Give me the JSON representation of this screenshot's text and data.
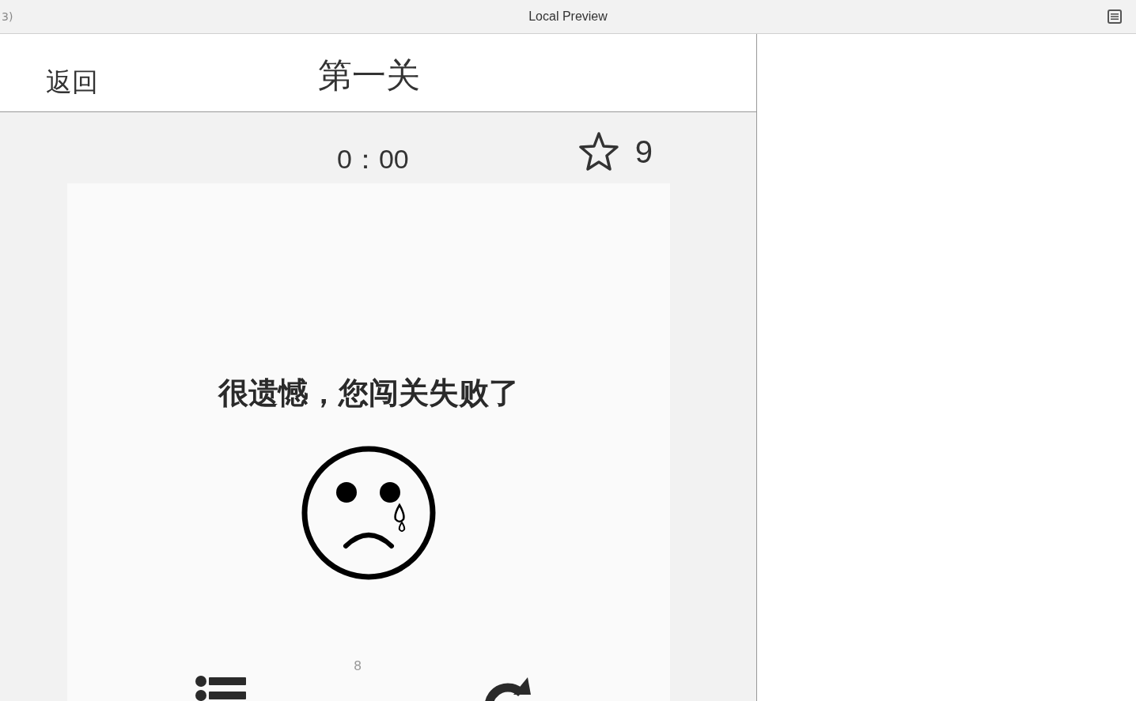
{
  "window": {
    "title": "Local Preview",
    "left_fragment": "3)"
  },
  "header": {
    "back": "返回",
    "title": "第一关"
  },
  "status": {
    "timer": "0：00",
    "score": "9"
  },
  "result": {
    "message": "很遗憾，您闯关失败了",
    "page_number": "8"
  }
}
